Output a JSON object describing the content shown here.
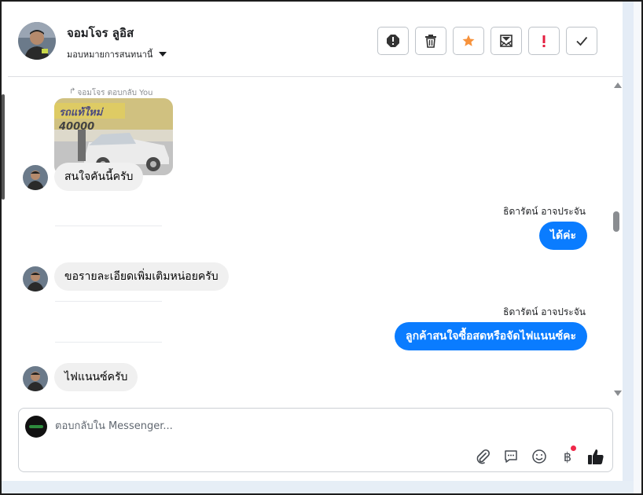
{
  "contact": {
    "name": "จอมโจร ลูอิส",
    "assign_label": "มอบหมายการสนทนานี้"
  },
  "toolbar": {
    "buttons": [
      {
        "name": "spam-button",
        "icon": "alert-octagon-icon"
      },
      {
        "name": "delete-button",
        "icon": "trash-icon"
      },
      {
        "name": "star-button",
        "icon": "star-icon",
        "color": "#f7923b"
      },
      {
        "name": "unread-button",
        "icon": "mail-icon"
      },
      {
        "name": "follow-up-button",
        "icon": "exclamation-icon",
        "color": "#e41e3f"
      },
      {
        "name": "done-button",
        "icon": "check-icon"
      }
    ]
  },
  "messages": {
    "reply_note": "จอมโจร ตอบกลับ You",
    "car_image_text": {
      "brand": "รถแท้ใหม่",
      "price": "40000"
    },
    "m1": "สนใจคันนี้ครับ",
    "s1": "ธิดารัตน์ อาจประจัน",
    "m2": "ได้ค่ะ",
    "m3": "ขอรายละเอียดเพิ่มเติมหน่อยครับ",
    "s2": "ธิดารัตน์ อาจประจัน",
    "m4": "ลูกค้าสนใจซื้อสดหรือจัดไฟแนนซ์คะ",
    "m5": "ไฟแนนซ์ครับ"
  },
  "composer": {
    "placeholder": "ตอบกลับใน Messenger...",
    "currency_symbol": "฿",
    "icons": [
      "paperclip-icon",
      "chat-bubble-icon",
      "smile-icon",
      "baht-icon",
      "thumbs-up-icon"
    ]
  },
  "colors": {
    "outgoing_bubble": "#0a7cff",
    "incoming_bubble": "#f0f0f0"
  }
}
